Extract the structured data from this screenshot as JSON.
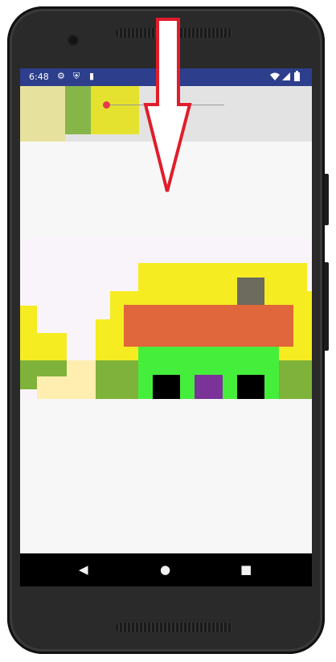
{
  "status_bar": {
    "time": "6:48",
    "icons_left": [
      "gear-icon",
      "shield-icon",
      "sd-card-icon"
    ],
    "icons_right": [
      "wifi-icon",
      "signal-icon",
      "battery-icon"
    ]
  },
  "player": {
    "seek_progress": 0.03
  },
  "scene": {
    "colors": {
      "yellow": "#f5ec22",
      "light_green": "#7fb23a",
      "pale_yellow": "#ffeeb0",
      "orange_roof": "#e0663b",
      "green_wall": "#46ee3c",
      "window": "#000000",
      "door": "#7b3399",
      "chimney": "#6b6b5e",
      "sky": "#f9f4f9"
    }
  },
  "annotation": {
    "arrow_direction": "down",
    "arrow_color": "#e11d2b"
  },
  "nav_bar": {
    "buttons": [
      "back-button",
      "home-button",
      "recents-button"
    ]
  }
}
